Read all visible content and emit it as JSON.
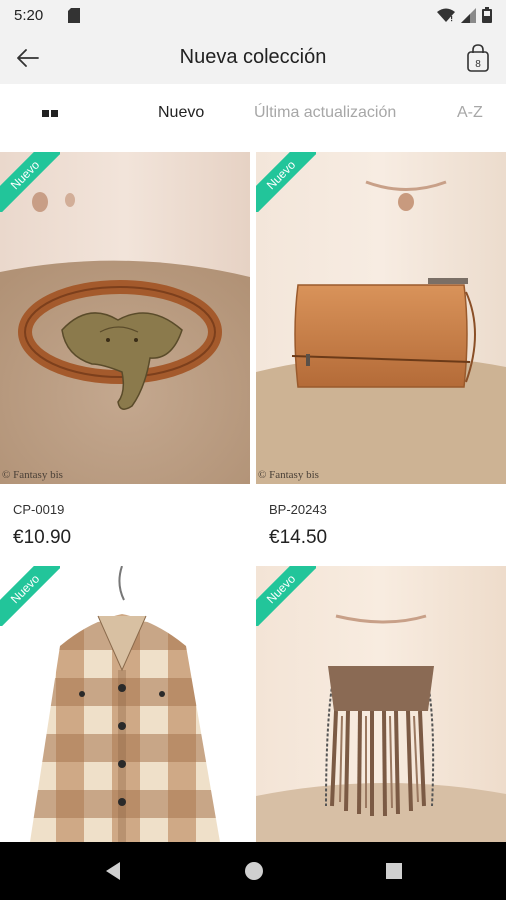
{
  "status_bar": {
    "time": "5:20"
  },
  "app_bar": {
    "title": "Nueva colección",
    "bag_count": "8"
  },
  "sort_bar": {
    "options": [
      {
        "label": "Nuevo",
        "selected": true
      },
      {
        "label": "Última actualización",
        "selected": false
      },
      {
        "label": "A-Z",
        "selected": false
      }
    ]
  },
  "products": [
    {
      "sku": "CP-0019",
      "price": "€10.90",
      "badge": "Nuevo",
      "watermark": "© Fantasy bis"
    },
    {
      "sku": "BP-20243",
      "price": "€14.50",
      "badge": "Nuevo",
      "watermark": "© Fantasy bis"
    },
    {
      "badge": "Nuevo"
    },
    {
      "badge": "Nuevo"
    }
  ],
  "colors": {
    "badge": "#22c59a",
    "header_bg": "#f2f2f2",
    "sort_inactive": "#a7a7a7"
  }
}
